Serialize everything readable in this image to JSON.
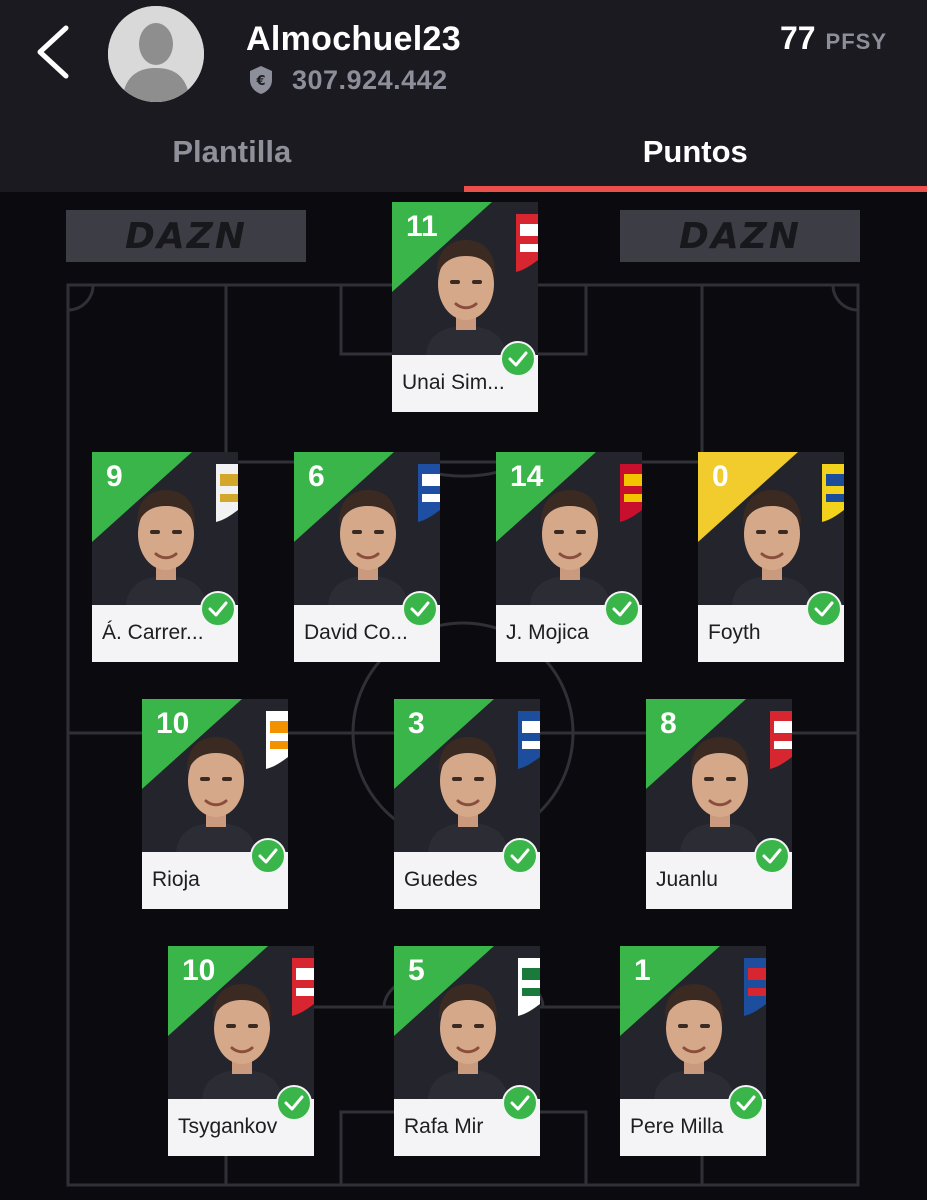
{
  "header": {
    "user_name": "Almochuel23",
    "team_value": "307.924.442",
    "points_value": "77",
    "points_unit": "PFSY",
    "icons": {
      "back": "chevron-left-icon",
      "avatar": "user-avatar-placeholder-icon",
      "money": "euro-shield-icon"
    }
  },
  "tabs": [
    {
      "label": "Plantilla",
      "active": false
    },
    {
      "label": "Puntos",
      "active": true
    }
  ],
  "pitch": {
    "sponsor_left": "DAZN",
    "sponsor_right": "DAZN"
  },
  "colors": {
    "accent": "#e9504a",
    "positive_points": "#3ab54a",
    "zero_points": "#f2cb2c",
    "header_bg": "#1b1a21",
    "pitch_bg": "#0a0a0f"
  },
  "players": [
    {
      "name": "Unai Sim...",
      "points": "11",
      "club": "Athletic Club",
      "status": "played",
      "color": "#3ab54a"
    },
    {
      "name": "Á. Carrer...",
      "points": "9",
      "club": "Real Madrid",
      "status": "played",
      "color": "#3ab54a"
    },
    {
      "name": "David Co...",
      "points": "6",
      "club": "Real Oviedo",
      "status": "played",
      "color": "#3ab54a"
    },
    {
      "name": "J. Mojica",
      "points": "14",
      "club": "RCD Mallorca",
      "status": "played",
      "color": "#3ab54a"
    },
    {
      "name": "Foyth",
      "points": "0",
      "club": "Villarreal",
      "status": "played",
      "color": "#f2cb2c"
    },
    {
      "name": "Rioja",
      "points": "10",
      "club": "Valencia",
      "status": "played",
      "color": "#3ab54a"
    },
    {
      "name": "Guedes",
      "points": "3",
      "club": "Real Sociedad",
      "status": "played",
      "color": "#3ab54a"
    },
    {
      "name": "Juanlu",
      "points": "8",
      "club": "Sevilla",
      "status": "played",
      "color": "#3ab54a"
    },
    {
      "name": "Tsygankov",
      "points": "10",
      "club": "Girona",
      "status": "played",
      "color": "#3ab54a"
    },
    {
      "name": "Rafa Mir",
      "points": "5",
      "club": "Elche",
      "status": "played",
      "color": "#3ab54a"
    },
    {
      "name": "Pere Milla",
      "points": "1",
      "club": "Espanyol",
      "status": "played",
      "color": "#3ab54a"
    }
  ]
}
